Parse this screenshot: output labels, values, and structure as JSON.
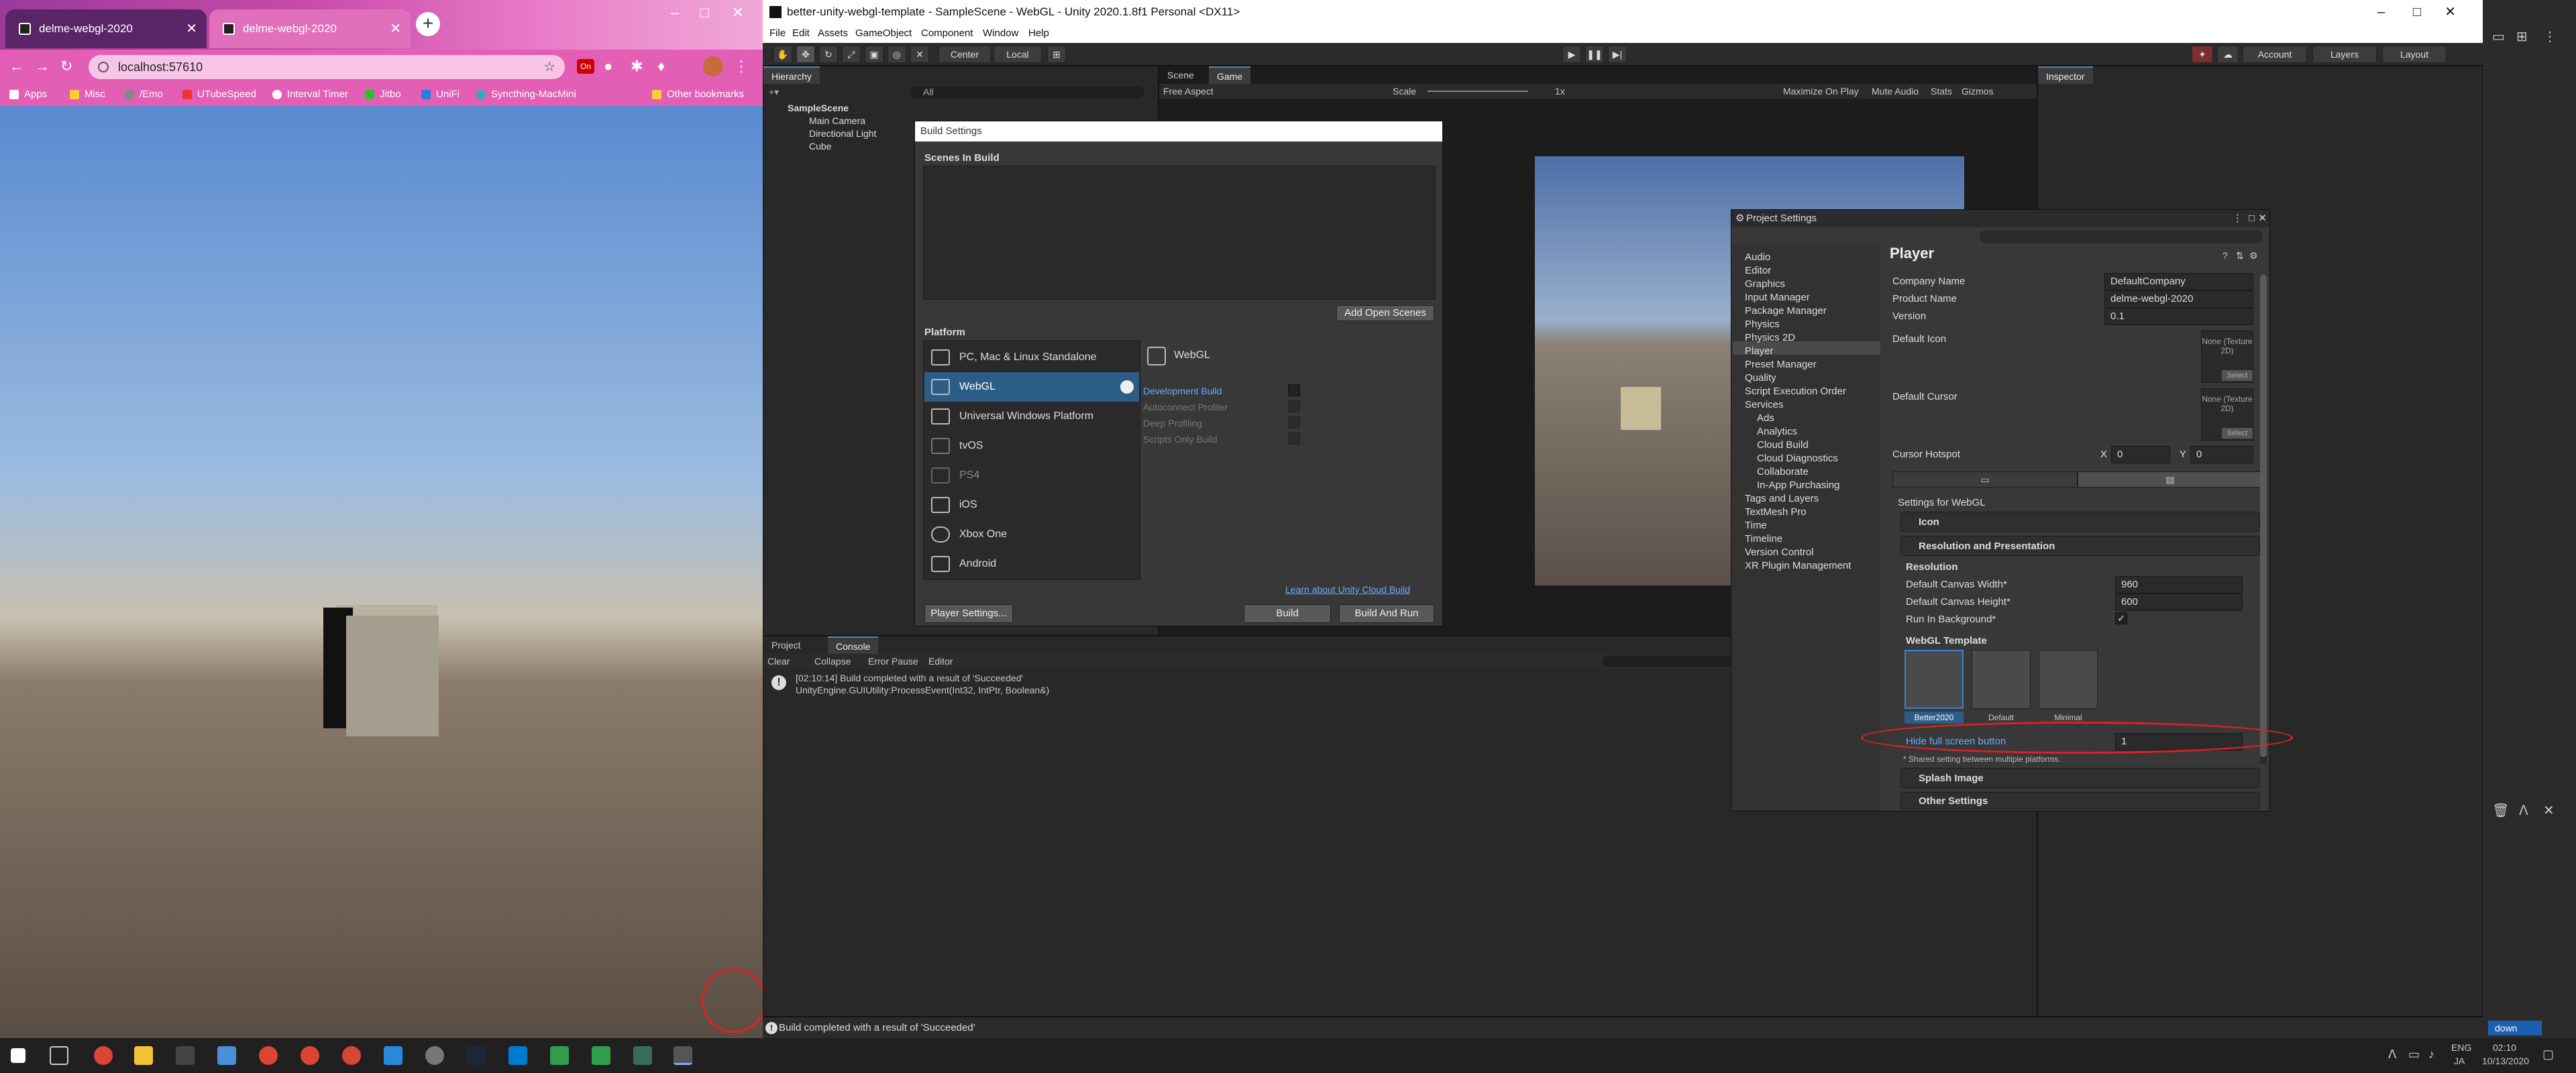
{
  "chrome": {
    "tabs": [
      {
        "title": "delme-webgl-2020"
      },
      {
        "title": "delme-webgl-2020"
      }
    ],
    "new_tab": "+",
    "url": "localhost:57610",
    "bookmarks": [
      "Apps",
      "Misc",
      "/Emo",
      "UTubeSpeed",
      "Interval Timer",
      "Jitbo",
      "UniFi",
      "Syncthing-MacMini"
    ],
    "other_bookmarks": "Other bookmarks",
    "ext_badge": "On"
  },
  "unity": {
    "title": "better-unity-webgl-template - SampleScene - WebGL - Unity 2020.1.8f1 Personal <DX11>",
    "menu": [
      "File",
      "Edit",
      "Assets",
      "GameObject",
      "Component",
      "Window",
      "Help"
    ],
    "toolbar": {
      "center": "Center",
      "local": "Local",
      "account": "Account",
      "layers": "Layers",
      "layout": "Layout"
    },
    "hierarchy": {
      "tab": "Hierarchy",
      "search_placeholder": "All",
      "scene": "SampleScene",
      "items": [
        "Main Camera",
        "Directional Light",
        "Cube"
      ]
    },
    "scene_tabs": {
      "scene": "Scene",
      "game": "Game"
    },
    "game_bar": {
      "aspect": "Free Aspect",
      "scale": "Scale",
      "scale_value": "1x",
      "maximize": "Maximize On Play",
      "mute": "Mute Audio",
      "stats": "Stats",
      "gizmos": "Gizmos"
    },
    "inspector": {
      "tab": "Inspector"
    },
    "console": {
      "tabs": [
        "Project",
        "Console"
      ],
      "buttons": [
        "Clear",
        "Collapse",
        "Error Pause",
        "Editor"
      ],
      "log_line1": "[02:10:14] Build completed with a result of 'Succeeded'",
      "log_line2": "UnityEngine.GUIUtility:ProcessEvent(Int32, IntPtr, Boolean&)"
    },
    "status": "Build completed with a result of 'Succeeded'"
  },
  "build_settings": {
    "title": "Build Settings",
    "scenes_header": "Scenes In Build",
    "add_open_scenes": "Add Open Scenes",
    "platform_header": "Platform",
    "platforms": [
      {
        "name": "PC, Mac & Linux Standalone",
        "dim": false
      },
      {
        "name": "WebGL",
        "dim": false
      },
      {
        "name": "Universal Windows Platform",
        "dim": false
      },
      {
        "name": "tvOS",
        "dim": false
      },
      {
        "name": "PS4",
        "dim": true
      },
      {
        "name": "iOS",
        "dim": false
      },
      {
        "name": "Xbox One",
        "dim": false
      },
      {
        "name": "Android",
        "dim": false
      }
    ],
    "selected_platform": "WebGL",
    "options": [
      "Development Build",
      "Autoconnect Profiler",
      "Deep Profiling",
      "Scripts Only Build"
    ],
    "cloud_link": "Learn about Unity Cloud Build",
    "player_settings": "Player Settings...",
    "build": "Build",
    "build_and_run": "Build And Run"
  },
  "project_settings": {
    "title": "Project Settings",
    "nav": [
      "Audio",
      "Editor",
      "Graphics",
      "Input Manager",
      "Package Manager",
      "Physics",
      "Physics 2D",
      "Player",
      "Preset Manager",
      "Quality",
      "Script Execution Order",
      "Services",
      "Ads",
      "Analytics",
      "Cloud Build",
      "Cloud Diagnostics",
      "Collaborate",
      "In-App Purchasing",
      "Tags and Layers",
      "TextMesh Pro",
      "Time",
      "Timeline",
      "Version Control",
      "XR Plugin Management"
    ],
    "page_title": "Player",
    "company_label": "Company Name",
    "company_value": "DefaultCompany",
    "product_label": "Product Name",
    "product_value": "delme-webgl-2020",
    "version_label": "Version",
    "version_value": "0.1",
    "default_icon": "Default Icon",
    "default_cursor": "Default Cursor",
    "none_texture": "None (Texture 2D)",
    "select": "Select",
    "hotspot_label": "Cursor Hotspot",
    "hotspot_x": "0",
    "hotspot_y": "0",
    "x_label": "X",
    "y_label": "Y",
    "settings_for": "Settings for WebGL",
    "icon_section": "Icon",
    "res_section": "Resolution and Presentation",
    "resolution": "Resolution",
    "canvas_width_label": "Default Canvas Width*",
    "canvas_width": "960",
    "canvas_height_label": "Default Canvas Height*",
    "canvas_height": "600",
    "run_bg_label": "Run In Background*",
    "check": "✓",
    "template_header": "WebGL Template",
    "templates": [
      "Better2020",
      "Default",
      "Minimal"
    ],
    "hide_fs_label": "Hide full screen button",
    "hide_fs_value": "1",
    "shared_note": "* Shared setting between multiple platforms.",
    "splash_section": "Splash Image",
    "other_section": "Other Settings"
  },
  "taskbar": {
    "lang1": "ENG",
    "lang2": "JA",
    "time": "02:10",
    "date": "10/13/2020",
    "notif": "down"
  }
}
